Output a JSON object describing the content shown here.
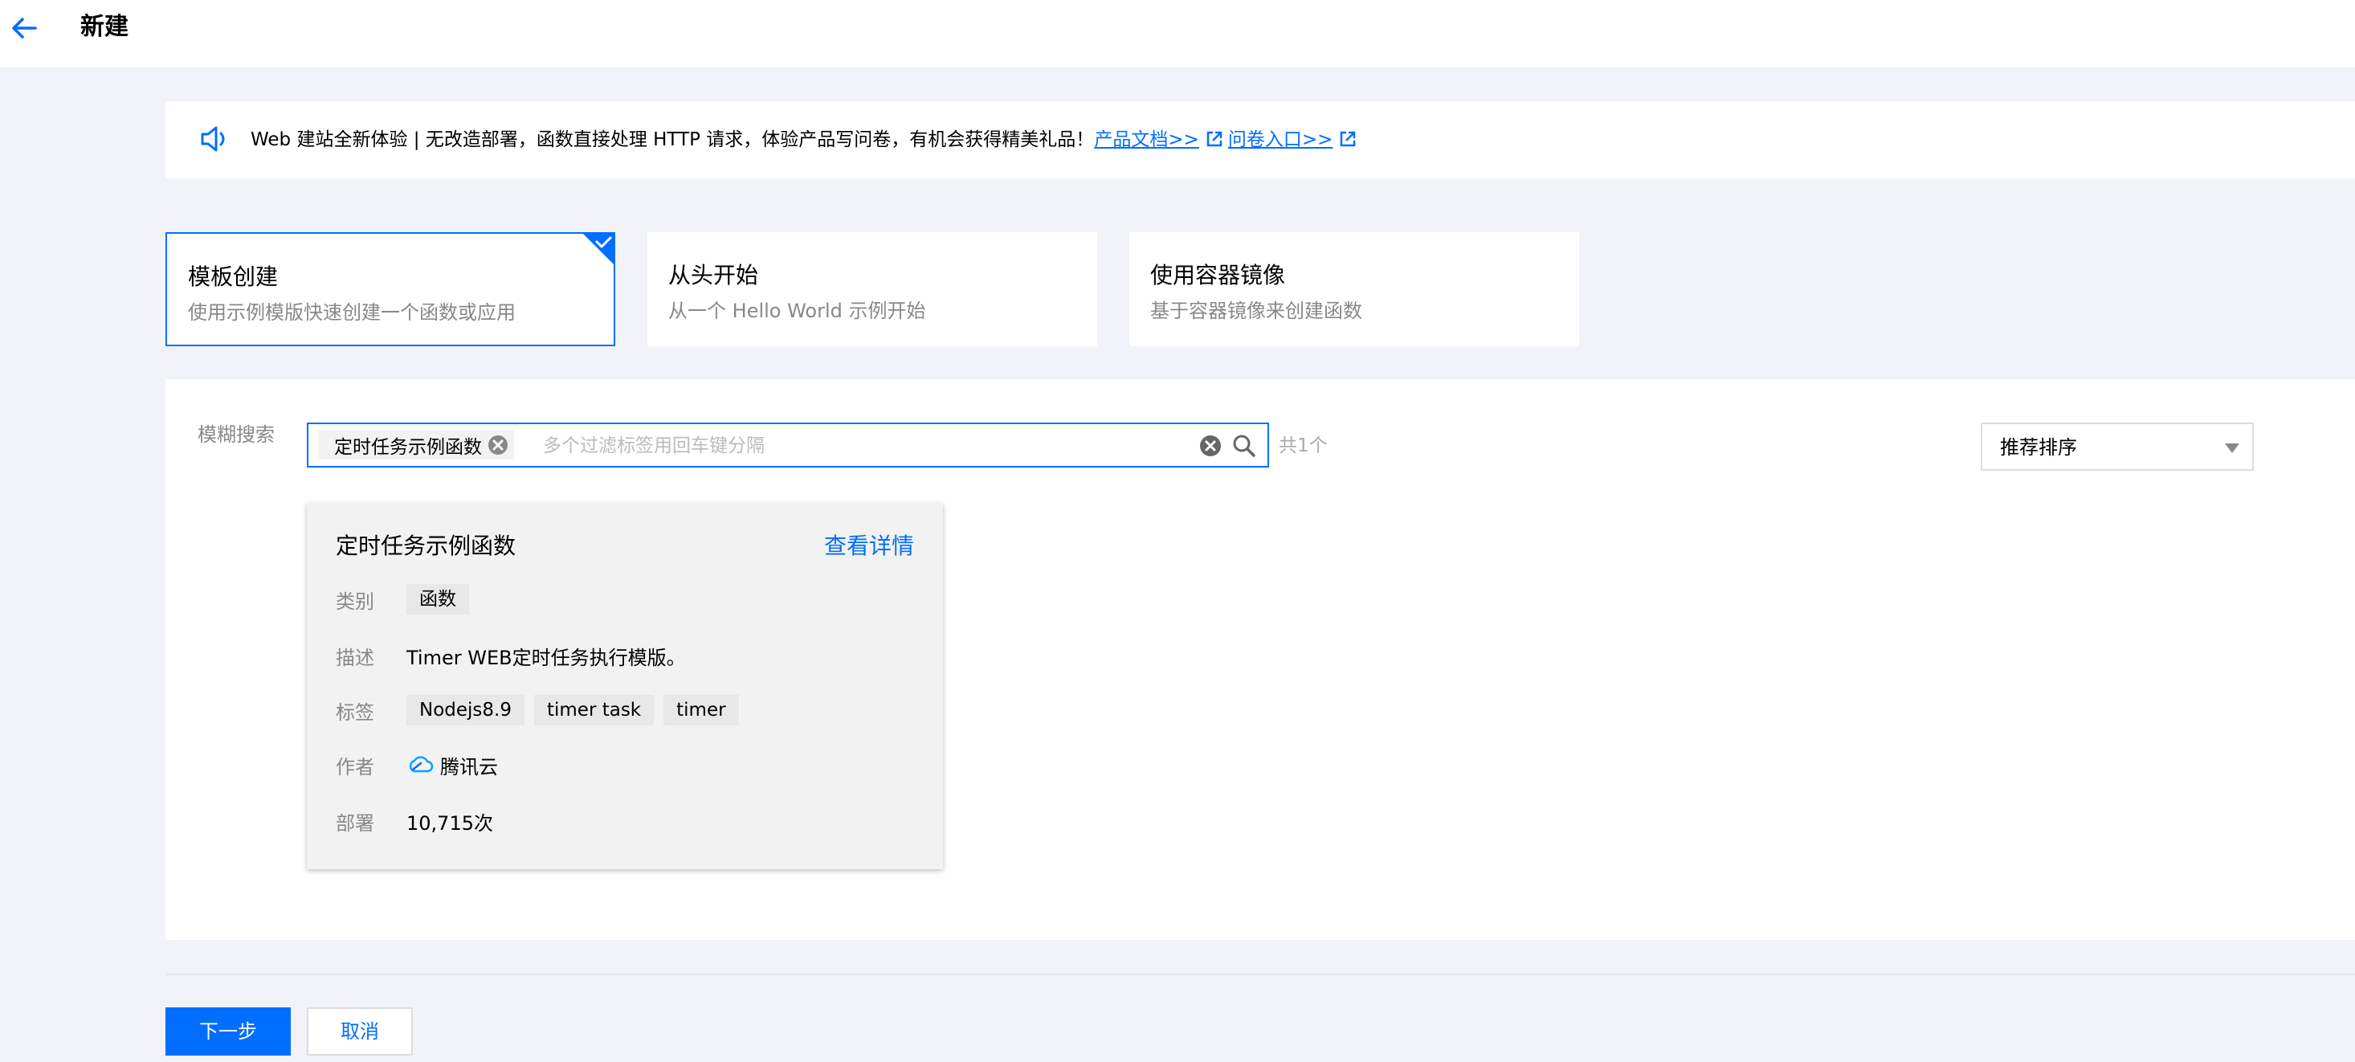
{
  "header": {
    "title": "新建"
  },
  "notice": {
    "text": "Web 建站全新体验 | 无改造部署，函数直接处理 HTTP 请求，体验产品写问卷，有机会获得精美礼品！",
    "link_docs": "产品文档>>",
    "link_survey": "问卷入口>>"
  },
  "modes": [
    {
      "title": "模板创建",
      "desc": "使用示例模版快速创建一个函数或应用",
      "selected": true
    },
    {
      "title": "从头开始",
      "desc": "从一个 Hello World 示例开始",
      "selected": false
    },
    {
      "title": "使用容器镜像",
      "desc": "基于容器镜像来创建函数",
      "selected": false
    }
  ],
  "search": {
    "label": "模糊搜索",
    "tag": "定时任务示例函数",
    "placeholder": "多个过滤标签用回车键分隔",
    "count": "共1个"
  },
  "sort": {
    "value": "推荐排序"
  },
  "template": {
    "name": "定时任务示例函数",
    "detail_link": "查看详情",
    "category_label": "类别",
    "category": "函数",
    "desc_label": "描述",
    "desc": "Timer WEB定时任务执行模版。",
    "tags_label": "标签",
    "tags": [
      "Nodejs8.9",
      "timer task",
      "timer"
    ],
    "author_label": "作者",
    "author": "腾讯云",
    "deploy_label": "部署",
    "deploy": "10,715次"
  },
  "footer": {
    "next": "下一步",
    "cancel": "取消"
  },
  "colors": {
    "accent": "#006eff",
    "background": "#f2f3f8"
  }
}
